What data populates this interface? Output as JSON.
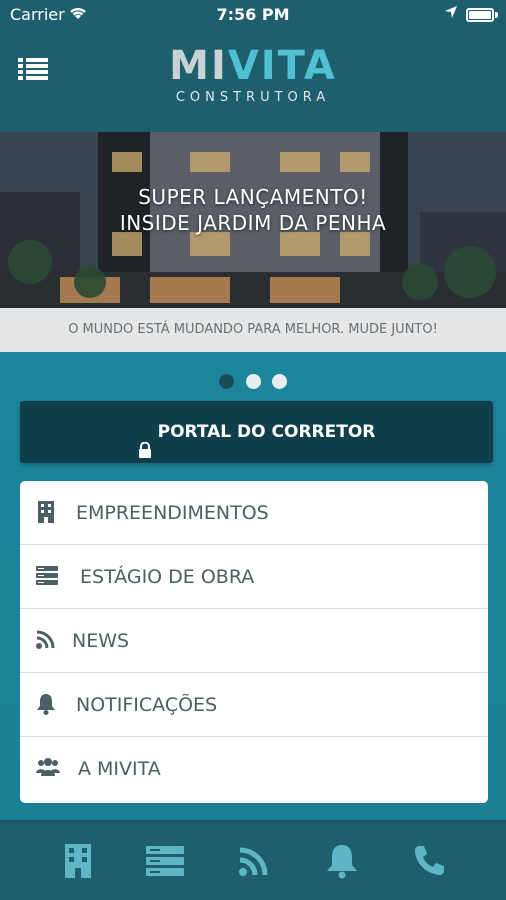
{
  "status_bar": {
    "carrier": "Carrier",
    "time": "7:56 PM"
  },
  "header": {
    "logo_mi": "MI",
    "logo_vita": "VITA",
    "logo_subtitle": "CONSTRUTORA",
    "menu_icon": "list-menu-icon"
  },
  "hero": {
    "title_line1": "SUPER LANÇAMENTO!",
    "title_line2": "INSIDE JARDIM DA PENHA",
    "tagline": "O MUNDO ESTÁ MUDANDO PARA MELHOR. MUDE JUNTO!"
  },
  "carousel": {
    "current": 1,
    "total": 3
  },
  "portal_button": {
    "label": "PORTAL DO CORRETOR",
    "icon": "lock-icon"
  },
  "menu": {
    "items": [
      {
        "label": "EMPREENDIMENTOS",
        "icon": "building-icon"
      },
      {
        "label": "ESTÁGIO DE OBRA",
        "icon": "server-stack-icon"
      },
      {
        "label": "NEWS",
        "icon": "rss-icon"
      },
      {
        "label": "NOTIFICAÇÕES",
        "icon": "bell-icon"
      },
      {
        "label": "A MIVITA",
        "icon": "users-icon"
      }
    ]
  },
  "bottom_nav": {
    "items": [
      "building-icon",
      "server-stack-icon",
      "rss-icon",
      "bell-icon",
      "phone-icon"
    ]
  },
  "colors": {
    "header_bg": "#1f5f6d",
    "page_bg": "#1d8aa0",
    "portal_bg": "#103f4b",
    "accent": "#4fc1d3"
  }
}
